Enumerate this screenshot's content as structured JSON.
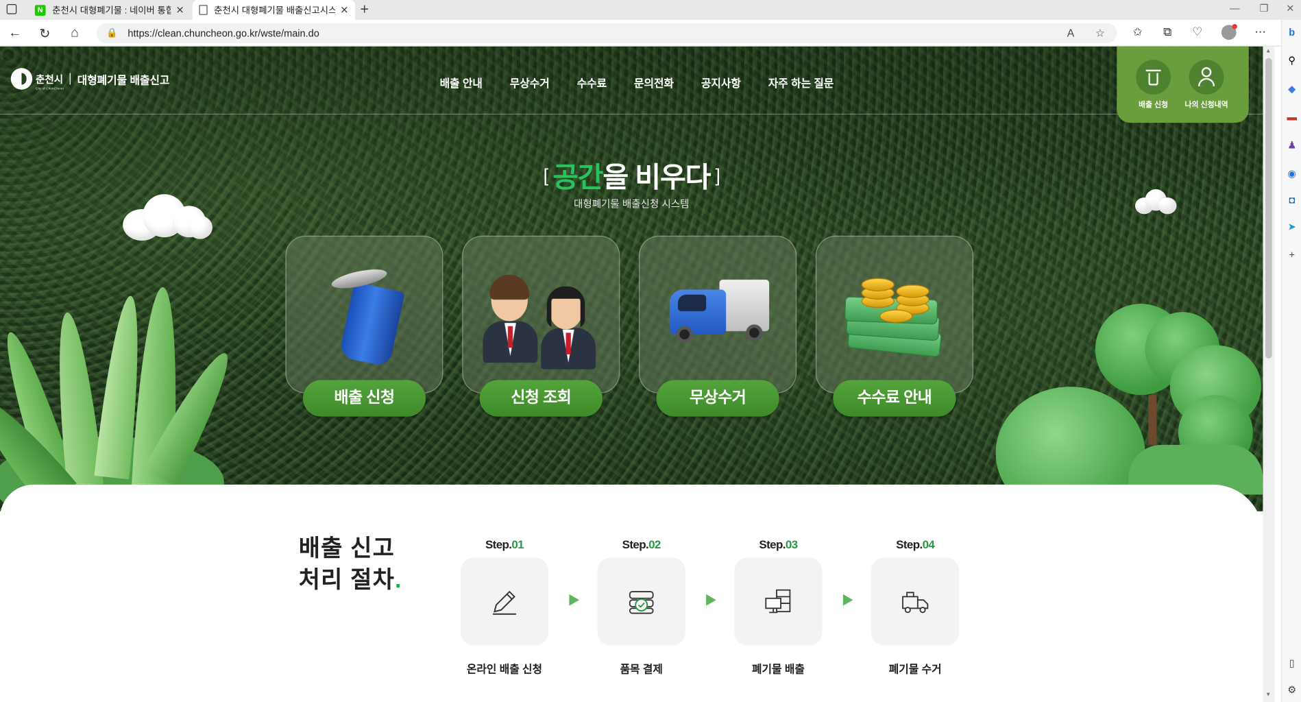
{
  "browser": {
    "tabs": [
      {
        "title": "춘천시 대형폐기물 : 네이버 통합",
        "favicon": "naver-icon",
        "active": false
      },
      {
        "title": "춘천시 대형폐기물 배출신고시스",
        "favicon": "page-icon",
        "active": true
      }
    ],
    "url": "https://clean.chuncheon.go.kr/wste/main.do"
  },
  "site": {
    "logo_city": "춘천시",
    "logo_city_en": "City of ChunCheon",
    "logo_title": "대형폐기물 배출신고",
    "nav": [
      "배출 안내",
      "무상수거",
      "수수료",
      "문의전화",
      "공지사항",
      "자주 하는 질문"
    ],
    "quick": [
      {
        "label": "배출 신청",
        "icon": "trash-icon"
      },
      {
        "label": "나의 신청내역",
        "icon": "user-icon"
      }
    ]
  },
  "hero": {
    "bracket_open": "[",
    "title_highlight": "공간",
    "title_rest": "을 비우다",
    "bracket_close": "]",
    "subtitle": "대형폐기물 배출신청 시스템",
    "cards": [
      {
        "label": "배출 신청",
        "icon": "trash-bin-icon"
      },
      {
        "label": "신청 조회",
        "icon": "people-icon"
      },
      {
        "label": "무상수거",
        "icon": "truck-icon"
      },
      {
        "label": "수수료 안내",
        "icon": "money-icon"
      }
    ]
  },
  "process": {
    "title_line1": "배출 신고",
    "title_line2": "처리 절차",
    "title_dot": ".",
    "steps": [
      {
        "prefix": "Step.",
        "num": "01",
        "name": "온라인 배출 신청",
        "icon": "pencil-icon"
      },
      {
        "prefix": "Step.",
        "num": "02",
        "name": "품목 결제",
        "icon": "payment-icon"
      },
      {
        "prefix": "Step.",
        "num": "03",
        "name": "폐기물 배출",
        "icon": "furniture-icon"
      },
      {
        "prefix": "Step.",
        "num": "04",
        "name": "폐기물 수거",
        "icon": "truck-icon"
      }
    ]
  },
  "colors": {
    "brand_green": "#27c35c",
    "button_green": "#3e8a2a",
    "quick_green": "#6a9e3c",
    "step_green": "#2a9646"
  }
}
